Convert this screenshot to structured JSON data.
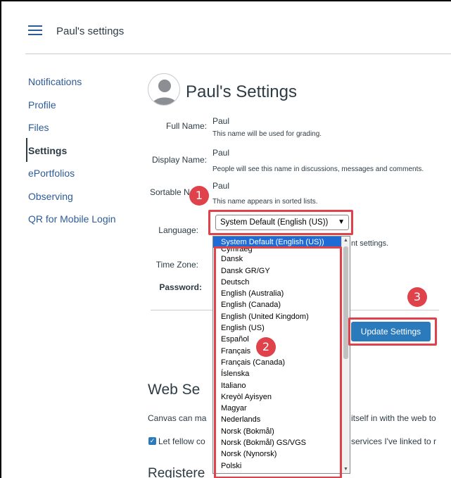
{
  "header": {
    "breadcrumb": "Paul's settings"
  },
  "sidebar": {
    "items": [
      {
        "label": "Notifications"
      },
      {
        "label": "Profile"
      },
      {
        "label": "Files"
      },
      {
        "label": "Settings",
        "active": true
      },
      {
        "label": "ePortfolios"
      },
      {
        "label": "Observing"
      },
      {
        "label": "QR for Mobile Login"
      }
    ]
  },
  "profile": {
    "title": "Paul's Settings",
    "full_name_label": "Full Name:",
    "full_name_value": "Paul",
    "full_name_hint": "This name will be used for grading.",
    "display_name_label": "Display Name:",
    "display_name_value": "Paul",
    "display_name_hint": "People will see this name in discussions, messages and comments.",
    "sortable_name_label": "Sortable N",
    "sortable_name_value": "Paul",
    "sortable_name_hint": "This name appears in sorted lists.",
    "language_label": "Language:",
    "language_selected": "System Default (English (US))",
    "language_hint_tail": "nt settings.",
    "timezone_label": "Time Zone:",
    "password_label": "Password:",
    "update_button": "Update Settings"
  },
  "language_options": [
    "System Default (English (US))",
    "Cymraeg",
    "Dansk",
    "Dansk GR/GY",
    "Deutsch",
    "English (Australia)",
    "English (Canada)",
    "English (United Kingdom)",
    "English (US)",
    "Español",
    "Français",
    "Français (Canada)",
    "Íslenska",
    "Italiano",
    "Kreyòl Ayisyen",
    "Magyar",
    "Nederlands",
    "Norsk (Bokmål)",
    "Norsk (Bokmål) GS/VGS",
    "Norsk (Nynorsk)",
    "Polski"
  ],
  "web_services": {
    "heading": "Web Se",
    "desc_left": "Canvas can ma",
    "desc_right": "itself in with the web to",
    "check_left": "Let fellow co",
    "check_right": "services I've linked to r",
    "registered_heading": "Registere"
  },
  "callouts": [
    "1",
    "2",
    "3"
  ],
  "colors": {
    "link": "#2d5b97",
    "accent": "#2b7abc",
    "callout": "#e0424b",
    "selected_option": "#1f6bd6"
  }
}
